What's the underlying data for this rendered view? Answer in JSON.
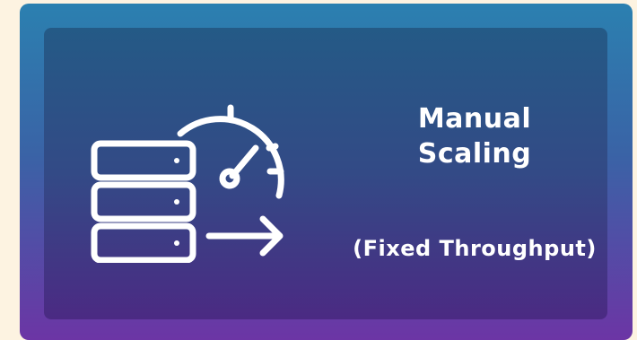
{
  "card": {
    "title_line1": "Manual",
    "title_line2": "Scaling",
    "subtitle": "(Fixed Throughput)",
    "icon": "server-speedometer-arrow-icon"
  }
}
